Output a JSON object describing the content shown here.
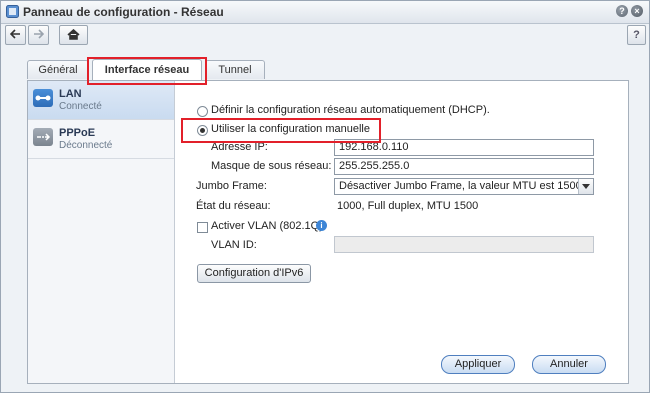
{
  "window": {
    "title": "Panneau de configuration - Réseau"
  },
  "toolbar": {
    "help_label": "?"
  },
  "tabs": [
    {
      "label": "Général"
    },
    {
      "label": "Interface réseau"
    },
    {
      "label": "Tunnel"
    }
  ],
  "sidebar": {
    "items": [
      {
        "name": "LAN",
        "status": "Connecté",
        "icon": "network-icon"
      },
      {
        "name": "PPPoE",
        "status": "Déconnecté",
        "icon": "pppoe-icon"
      }
    ]
  },
  "form": {
    "dhcp_label": "Définir la configuration réseau automatiquement (DHCP).",
    "manual_label": "Utiliser la configuration manuelle",
    "ip_label": "Adresse IP:",
    "ip_value": "192.168.0.110",
    "mask_label": "Masque de sous réseau:",
    "mask_value": "255.255.255.0",
    "jumbo_label": "Jumbo Frame:",
    "jumbo_value": "Désactiver Jumbo Frame, la valeur MTU est 1500",
    "status_label": "État du réseau:",
    "status_value": "1000, Full duplex, MTU 1500",
    "vlan_checkbox_label": "Activer VLAN (802.1Q)",
    "vlan_id_label": "VLAN ID:",
    "vlan_id_value": "",
    "ipv6_button": "Configuration d'IPv6"
  },
  "footer": {
    "apply_label": "Appliquer",
    "cancel_label": "Annuler"
  },
  "colors": {
    "highlight": "#e2202a",
    "accent": "#3d85d6"
  }
}
